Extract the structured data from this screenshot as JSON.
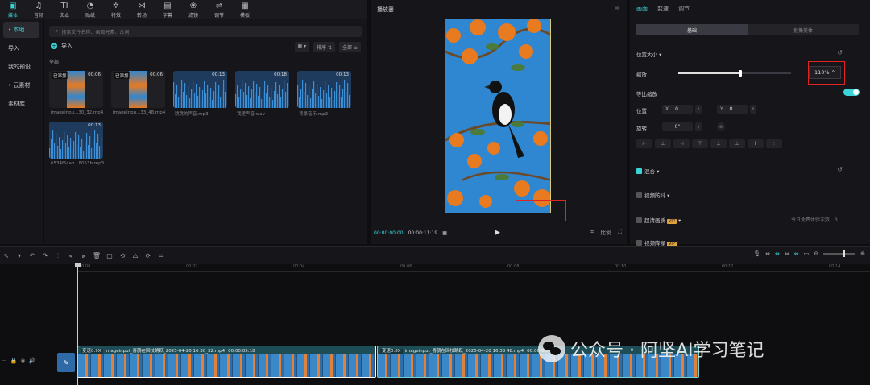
{
  "toolbar": {
    "items": [
      {
        "label": "媒体",
        "icon": "media-icon",
        "glyph": "▣"
      },
      {
        "label": "音频",
        "icon": "audio-icon",
        "glyph": "♫"
      },
      {
        "label": "文本",
        "icon": "text-icon",
        "glyph": "TI"
      },
      {
        "label": "贴纸",
        "icon": "sticker-icon",
        "glyph": "◔"
      },
      {
        "label": "特效",
        "icon": "effects-icon",
        "glyph": "✲"
      },
      {
        "label": "转场",
        "icon": "transition-icon",
        "glyph": "⋈"
      },
      {
        "label": "字幕",
        "icon": "caption-icon",
        "glyph": "▤"
      },
      {
        "label": "滤镜",
        "icon": "filter-icon",
        "glyph": "❀"
      },
      {
        "label": "调节",
        "icon": "adjust-icon",
        "glyph": "⇌"
      },
      {
        "label": "模板",
        "icon": "template-icon",
        "glyph": "▦"
      }
    ]
  },
  "leftnav": {
    "items": [
      "• 本地",
      "导入",
      "我的预设",
      "• 云素材",
      "素材库"
    ]
  },
  "media": {
    "search_placeholder": "搜索文件名称、画面元素、台词",
    "import_label": "导入",
    "sort_label": "排序",
    "filter_label": "全部",
    "section_label": "全部",
    "items": [
      {
        "name": "imageinpu...30_32.mp4",
        "duration": "00:06",
        "tag": "已添加"
      },
      {
        "name": "imageinpu...33_48.mp4",
        "duration": "00:06",
        "tag": "已添加"
      },
      {
        "name": "跳跳的声音.mp3",
        "duration": "00:13"
      },
      {
        "name": "我建声音.wav",
        "duration": "00:18"
      },
      {
        "name": "背景音乐.mp3",
        "duration": "00:13"
      },
      {
        "name": "6534f5cab...8053b.mp3",
        "duration": "00:13"
      }
    ]
  },
  "player": {
    "title": "播放器",
    "current_time": "00:00:00:00",
    "total_time": "00:00:11:19",
    "ratio_label": "比例"
  },
  "inspector": {
    "tabs": [
      "画面",
      "变速",
      "调节"
    ],
    "subtabs": [
      "基础",
      "抠像美体"
    ],
    "position_size_label": "位置大小",
    "scale_label": "缩放",
    "scale_value": "110%",
    "scale_fraction": 0.55,
    "uniform_label": "等比缩放",
    "position_label": "位置",
    "pos_x_label": "X",
    "pos_x": "0",
    "pos_y_label": "Y",
    "pos_y": "0",
    "rotate_label": "旋转",
    "rotate_value": "0°",
    "align_buttons": [
      "⊢",
      "⊥",
      "⊣",
      "⊤",
      "⊥",
      "⊥",
      "⫴",
      "⫶"
    ],
    "blend_label": "混合",
    "stabilize_label": "视频防抖",
    "enhance_label": "超清画质",
    "enhance_note": "今日免费体验次数：3",
    "denoise_label": "视频降噪",
    "vip": "VIP"
  },
  "timeline": {
    "ticks": [
      "00:00",
      "00:02",
      "00:04",
      "00:06",
      "00:08",
      "00:10",
      "00:12",
      "00:14"
    ],
    "clips": [
      {
        "speed": "变速0.9X",
        "name": "imageinput_喜鹊在回枝跳跃_2025-04-20 16 30_32.mp4",
        "duration": "00:00:05:18"
      },
      {
        "speed": "变速0.8X",
        "name": "imageinput_喜鹊在回枝跳跃_2025-04-20 16 33 48.mp4",
        "duration": "00:00:06:01"
      }
    ]
  },
  "watermark": {
    "text": "公众号 · 阿坚AI学习笔记"
  },
  "colors": {
    "accent": "#3ad4d8",
    "highlight": "#e02424"
  }
}
